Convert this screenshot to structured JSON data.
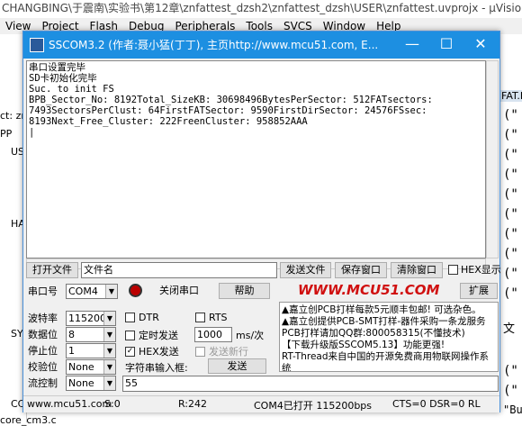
{
  "bg": {
    "title": "CHANGBING\\于震南\\实验书\\第12章\\znfattest_dzsh2\\znfattest_dzsh\\USER\\znfattest.uvprojx - µVision",
    "menu": [
      "View",
      "Project",
      "Flash",
      "Debug",
      "Peripherals",
      "Tools",
      "SVCS",
      "Window",
      "Help"
    ],
    "left_texts": [
      "ct: zn",
      "PP",
      "US",
      "HA",
      "SY",
      "CC",
      "core_cm3.c"
    ],
    "right_tab": "FAT.H",
    "right_texts": [
      "文",
      "\"Bu"
    ]
  },
  "window": {
    "title": "SSCOM3.2 (作者:聂小猛(丁丁), 主页http://www.mcu51.com,  E..."
  },
  "terminal": {
    "lines": [
      "串口设置完毕",
      "SD卡初始化完毕",
      "Suc. to init FS",
      "BPB_Sector_No: 8192Total_SizeKB: 30698496BytesPerSector: 512FATsectors:",
      "7493SectorsPerClust: 64FirstFATSector: 9590FirstDirSector: 24576FSsec:",
      "8193Next_Free_Cluster: 222FreenCluster: 958852AAA"
    ]
  },
  "controls": {
    "open_file": "打开文件",
    "filename": "文件名",
    "send_file": "发送文件",
    "save_window": "保存窗口",
    "clear_window": "清除窗口",
    "hex_display": "HEX显示",
    "port_label": "串口号",
    "port_value": "COM4",
    "close_port": "关闭串口",
    "help": "帮助",
    "logo": "WWW.MCU51.COM",
    "expand": "扩展",
    "baud_label": "波特率",
    "baud_value": "115200",
    "databits_label": "数据位",
    "databits_value": "8",
    "stopbits_label": "停止位",
    "stopbits_value": "1",
    "parity_label": "校验位",
    "parity_value": "None",
    "flow_label": "流控制",
    "flow_value": "None",
    "dtr": "DTR",
    "rts": "RTS",
    "timed_send": "定时发送",
    "interval": "1000",
    "interval_unit": "ms/次",
    "hex_send": "HEX发送",
    "send_newline": "发送新行",
    "input_label": "字符串输入框:",
    "send": "发送",
    "input_value": "55"
  },
  "ads": [
    "▲嘉立创PCB打样每款5元顺丰包邮! 可选杂色。",
    "▲嘉立创提供PCB-SMT打样-器件采购一条龙服务",
    "PCB打样请加QQ群:800058315(不懂技术)",
    "【下载升级版SSCOM5.13】功能更强!",
    "RT-Thread来自中国的开源免费商用物联网操作系统"
  ],
  "status": {
    "site": "www.mcu51.com",
    "s": "S:0",
    "r": "R:242",
    "port": "COM4已打开  115200bps",
    "cts": "CTS=0 DSR=0 RL"
  },
  "colors": {
    "title_bar": "#1d8fe1",
    "logo": "#d01010"
  }
}
